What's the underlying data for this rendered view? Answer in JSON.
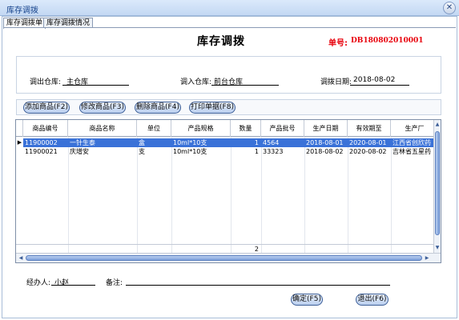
{
  "window": {
    "title": "库存调拨",
    "close_glyph": "✕"
  },
  "tabs": [
    {
      "label": "库存调拨单",
      "active": true
    },
    {
      "label": "库存调拨情况",
      "active": false
    }
  ],
  "form": {
    "title": "库存调拨",
    "order_label": "单号:",
    "order_no": "DB180802010001"
  },
  "info": {
    "out_label": "调出仓库:",
    "out_value": "主仓库",
    "in_label": "调入仓库:",
    "in_value": "前台仓库",
    "date_label": "调拨日期:",
    "date_value": "2018-08-02"
  },
  "toolbar": {
    "add": "添加商品(F2)",
    "edit": "修改商品(F3)",
    "delete": "删除商品(F4)",
    "print": "打印单据(F8)"
  },
  "grid": {
    "columns": [
      "商品编号",
      "商品名称",
      "单位",
      "产品规格",
      "数量",
      "产品批号",
      "生产日期",
      "有效期至",
      "生产厂"
    ],
    "rows": [
      [
        "11900002",
        "一针生泰",
        "盒",
        "10ml*10支",
        "1",
        "4564",
        "2018-08-01",
        "2020-08-01",
        "江西省创欣药"
      ],
      [
        "11900021",
        "庆增安",
        "支",
        "10ml*10支",
        "1",
        "33323",
        "2018-08-02",
        "2020-08-02",
        "吉林省五星药"
      ]
    ],
    "selected_row": 0,
    "total_qty": "2"
  },
  "footer": {
    "handler_label": "经办人:",
    "handler_value": "小赵",
    "note_label": "备注:",
    "note_value": "",
    "confirm": "确定(F5)",
    "exit": "退出(F6)"
  },
  "colors": {
    "accent": "#3a72d8",
    "order": "#e8000b"
  }
}
